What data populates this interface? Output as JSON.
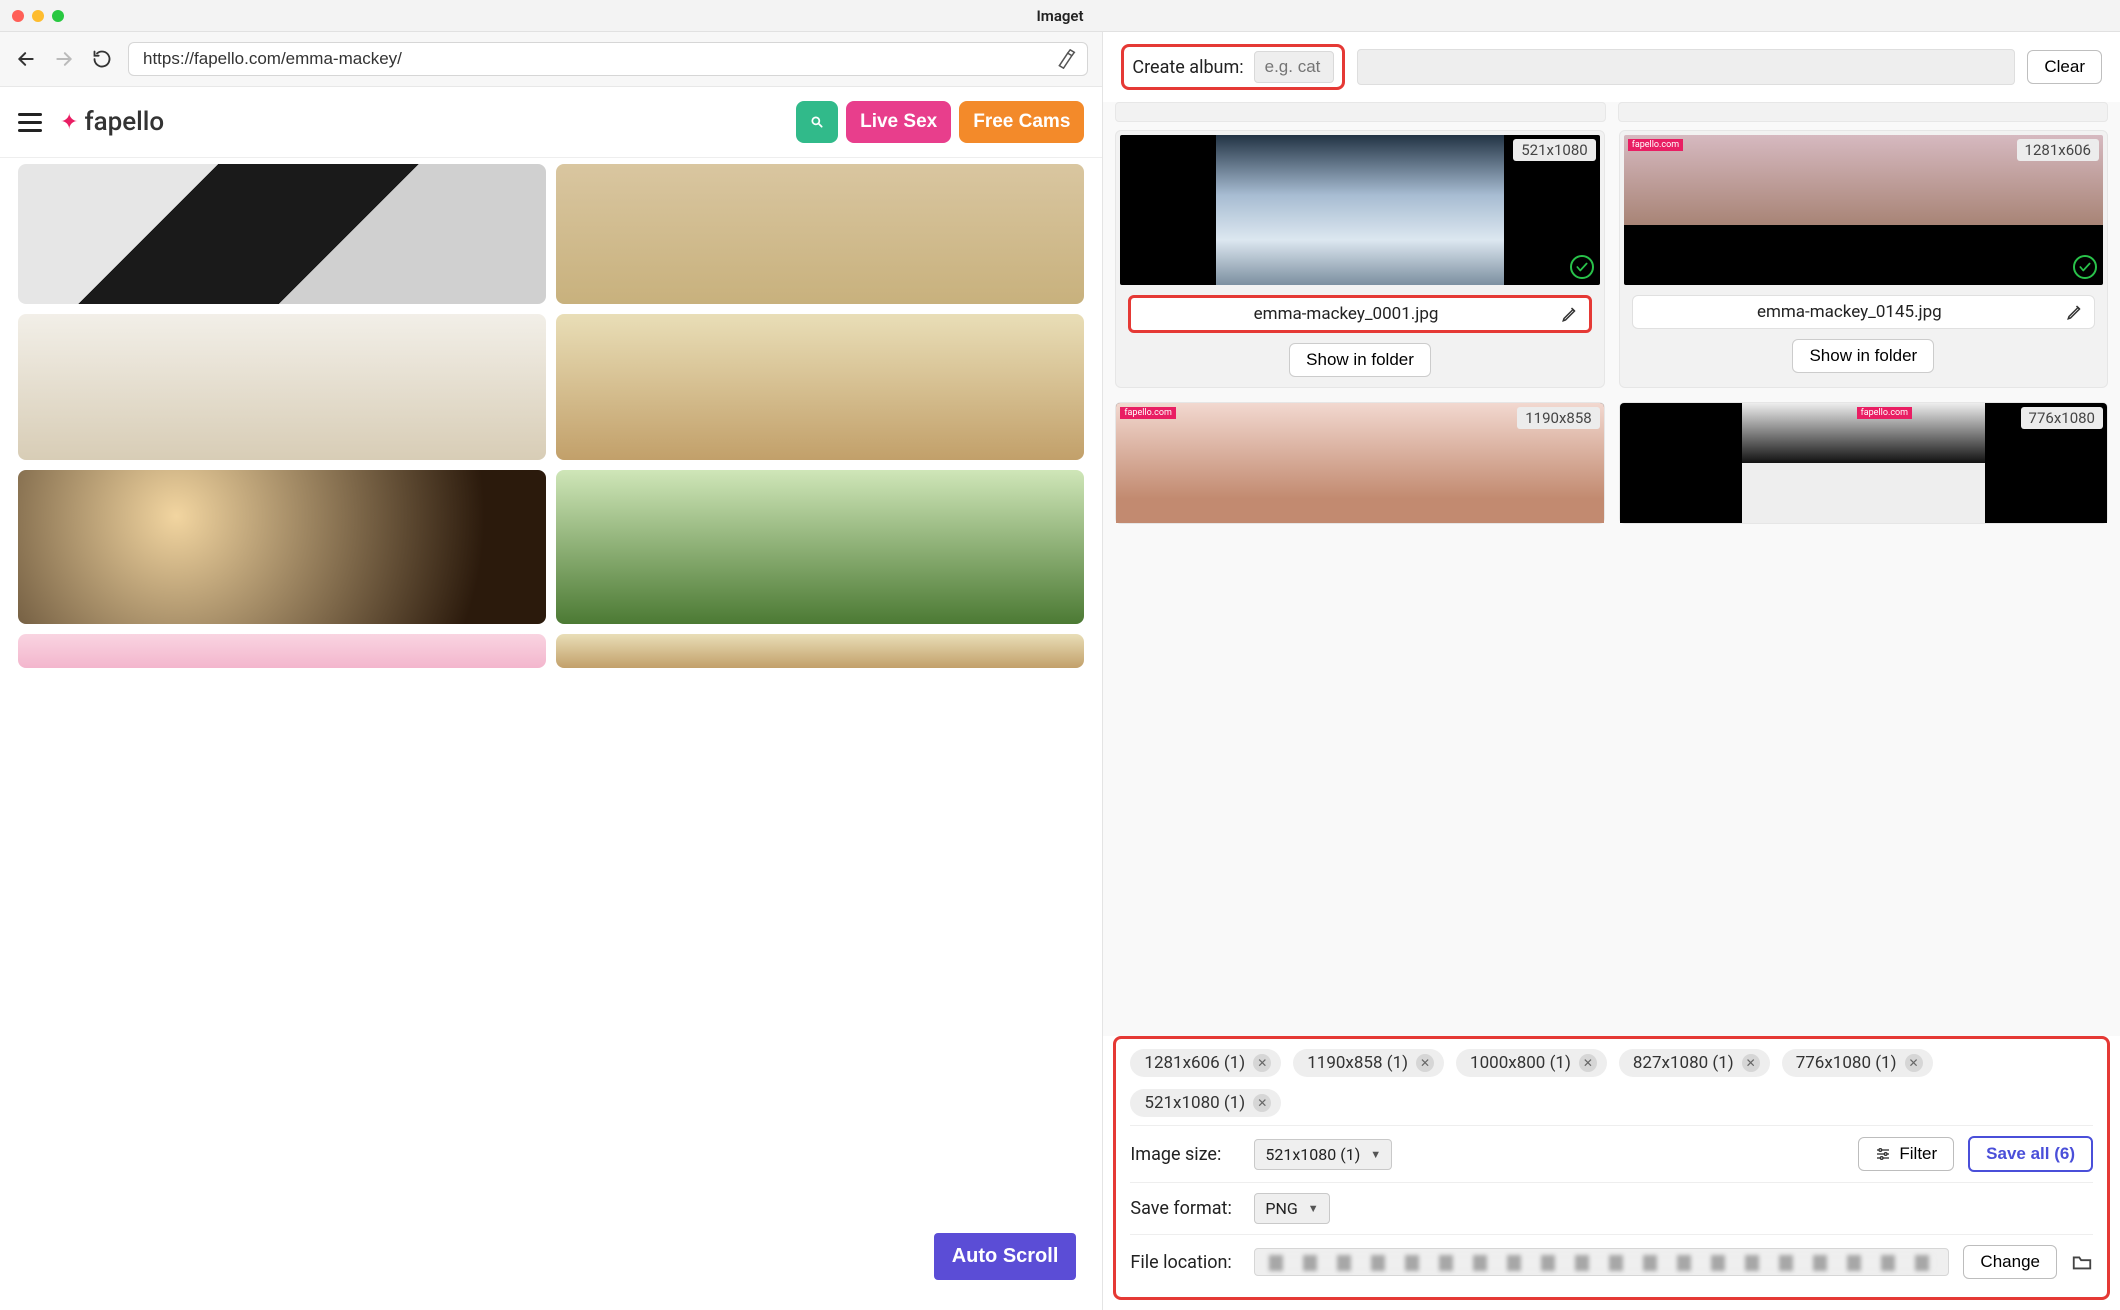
{
  "window": {
    "title": "Imaget"
  },
  "browser": {
    "url": "https://fapello.com/emma-mackey/",
    "site_name": "fapello",
    "live_sex": "Live Sex",
    "free_cams": "Free Cams",
    "auto_scroll": "Auto Scroll"
  },
  "album": {
    "create_label": "Create album:",
    "placeholder": "e.g. cat",
    "clear": "Clear"
  },
  "results": [
    {
      "dims": "521x1080",
      "filename": "emma-mackey_0001.jpg",
      "show": "Show in folder",
      "highlighted": true
    },
    {
      "dims": "1281x606",
      "filename": "emma-mackey_0145.jpg",
      "show": "Show in folder",
      "highlighted": false
    },
    {
      "dims": "1190x858"
    },
    {
      "dims": "776x1080"
    }
  ],
  "chips": [
    "1281x606 (1)",
    "1190x858 (1)",
    "1000x800 (1)",
    "827x1080 (1)",
    "776x1080 (1)",
    "521x1080 (1)"
  ],
  "controls": {
    "image_size_label": "Image size:",
    "image_size_value": "521x1080 (1)",
    "filter": "Filter",
    "save_all": "Save all (6)",
    "save_format_label": "Save format:",
    "save_format_value": "PNG",
    "file_location_label": "File location:",
    "change": "Change"
  }
}
